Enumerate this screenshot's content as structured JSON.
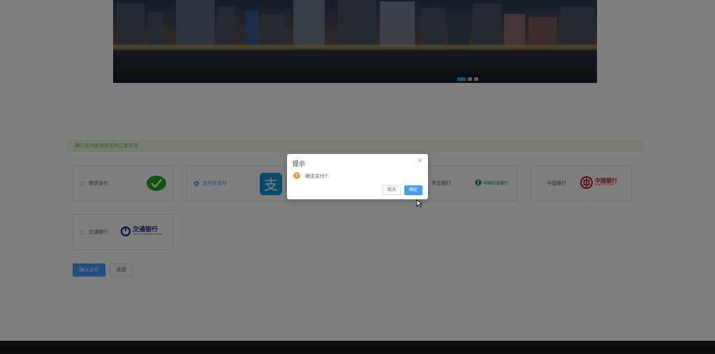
{
  "notice": {
    "text": "确认支付前请先核对订单信息"
  },
  "payments": [
    {
      "label": "微信支付",
      "logo": "wechat-pay-icon",
      "checked": false
    },
    {
      "label": "支付宝支付",
      "logo": "alipay-icon",
      "checked": true
    },
    {
      "label": "农业银行",
      "logo_text": "中国农业银行",
      "checked": false
    },
    {
      "label": "中国银行",
      "logo_text": "中国银行",
      "logo_sub": "BANK OF CHINA",
      "checked": false
    },
    {
      "label": "交通银行",
      "logo_text": "交通银行",
      "logo_sub": "BANK OF COMMUNICATIONS",
      "checked": false
    }
  ],
  "actions": {
    "confirm_label": "确认支付",
    "back_label": "返回"
  },
  "dialog": {
    "title": "提示",
    "message": "确定支付?",
    "cancel_label": "取消",
    "confirm_label": "确定",
    "close_glyph": "×",
    "warn_glyph": "!"
  },
  "colors": {
    "primary": "#409eff",
    "warning": "#e6a23c",
    "notice_bg": "#f0f9eb",
    "footer": "#1a1a1a"
  }
}
